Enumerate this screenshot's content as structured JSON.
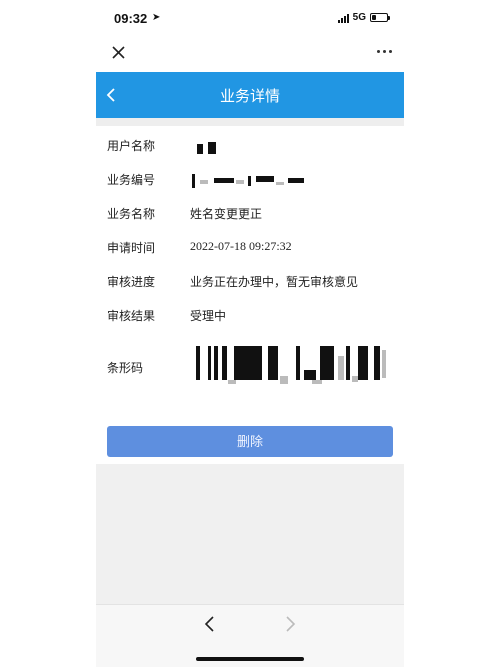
{
  "status_bar": {
    "time": "09:32",
    "network": "5G",
    "battery_level": 0.3
  },
  "header": {
    "title": "业务详情"
  },
  "details": [
    {
      "label": "用户名称",
      "value": ""
    },
    {
      "label": "业务编号",
      "value": ""
    },
    {
      "label": "业务名称",
      "value": "姓名变更更正"
    },
    {
      "label": "申请时间",
      "value": "2022-07-18 09:27:32"
    },
    {
      "label": "审核进度",
      "value": "业务正在办理中，暂无审核意见"
    },
    {
      "label": "审核结果",
      "value": "受理中"
    },
    {
      "label": "条形码",
      "value": ""
    }
  ],
  "actions": {
    "delete_label": "删除"
  },
  "icons": {
    "close": "close-icon",
    "more": "more-icon",
    "back": "chevron-left-icon",
    "nav_back": "chevron-left-icon",
    "nav_forward": "chevron-right-icon"
  },
  "colors": {
    "header_bg": "#2196e3",
    "button_bg": "#5e8fdf"
  }
}
